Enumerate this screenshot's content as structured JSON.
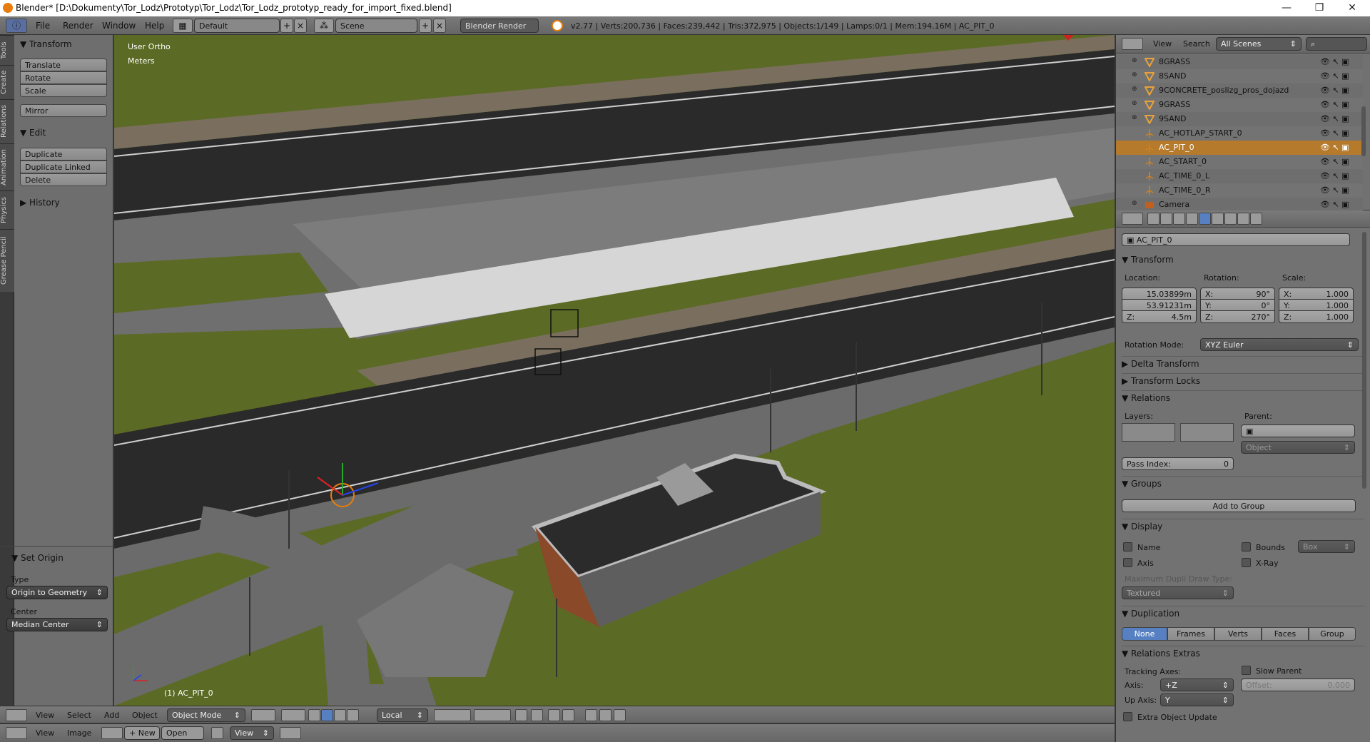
{
  "window": {
    "title": "Blender* [D:\\Dokumenty\\Tor_Lodz\\Prototyp\\Tor_Lodz\\Tor_Lodz_prototyp_ready_for_import_fixed.blend]",
    "min": "—",
    "max": "❐",
    "close": "✕"
  },
  "info": {
    "menus": [
      "File",
      "Render",
      "Window",
      "Help"
    ],
    "layout": "Default",
    "scene": "Scene",
    "engine": "Blender Render",
    "stats": "v2.77 | Verts:200,736 | Faces:239,442 | Tris:372,975 | Objects:1/149 | Lamps:0/1 | Mem:194.16M | AC_PIT_0"
  },
  "tabs": [
    "Tools",
    "Create",
    "Relations",
    "Animation",
    "Physics",
    "Grease Pencil"
  ],
  "shelf": {
    "transform_title": "Transform",
    "transform": [
      "Translate",
      "Rotate",
      "Scale"
    ],
    "mirror": "Mirror",
    "edit_title": "Edit",
    "edit": [
      "Duplicate",
      "Duplicate Linked",
      "Delete"
    ],
    "history_title": "History",
    "origin_title": "Set Origin",
    "type_label": "Type",
    "type_value": "Origin to Geometry",
    "center_label": "Center",
    "center_value": "Median Center"
  },
  "viewport": {
    "view_name": "User Ortho",
    "units": "Meters",
    "object_label": "(1) AC_PIT_0"
  },
  "vpheader": {
    "menus": [
      "View",
      "Select",
      "Add",
      "Object"
    ],
    "mode": "Object Mode",
    "orientation": "Local"
  },
  "imgheader": {
    "menus": [
      "View",
      "Image"
    ],
    "new": "New",
    "open": "Open",
    "view": "View"
  },
  "outliner": {
    "menus": [
      "View",
      "Search"
    ],
    "filter": "All Scenes",
    "rows": [
      {
        "name": "8GRASS",
        "type": "mesh"
      },
      {
        "name": "8SAND",
        "type": "mesh"
      },
      {
        "name": "9CONCRETE_poslizg_pros_dojazd",
        "type": "mesh"
      },
      {
        "name": "9GRASS",
        "type": "mesh"
      },
      {
        "name": "9SAND",
        "type": "mesh"
      },
      {
        "name": "AC_HOTLAP_START_0",
        "type": "empty"
      },
      {
        "name": "AC_PIT_0",
        "type": "empty",
        "selected": true
      },
      {
        "name": "AC_START_0",
        "type": "empty"
      },
      {
        "name": "AC_TIME_0_L",
        "type": "empty"
      },
      {
        "name": "AC_TIME_0_R",
        "type": "empty"
      },
      {
        "name": "Camera",
        "type": "camera"
      }
    ]
  },
  "props": {
    "object_name": "AC_PIT_0",
    "transform_title": "Transform",
    "location_label": "Location:",
    "rotation_label": "Rotation:",
    "scale_label": "Scale:",
    "loc": [
      "15.03899m",
      "53.91231m",
      "4.5m"
    ],
    "rot": [
      "90°",
      "0°",
      "270°"
    ],
    "scale": [
      "1.000",
      "1.000",
      "1.000"
    ],
    "axes": [
      "X:",
      "Y:",
      "Z:"
    ],
    "rotmode_label": "Rotation Mode:",
    "rotmode": "XYZ Euler",
    "delta": "Delta Transform",
    "locks": "Transform Locks",
    "relations_title": "Relations",
    "layers_label": "Layers:",
    "parent_label": "Parent:",
    "parent_type": "Object",
    "pass_index_label": "Pass Index:",
    "pass_index": "0",
    "groups_title": "Groups",
    "add_group": "Add to Group",
    "display_title": "Display",
    "name_chk": "Name",
    "axis_chk": "Axis",
    "bounds_chk": "Bounds",
    "bounds_type": "Box",
    "xray_chk": "X-Ray",
    "dupli_draw_label": "Maximum Dupli Draw Type:",
    "dupli_draw": "Textured",
    "duplication_title": "Duplication",
    "dup": [
      "None",
      "Frames",
      "Verts",
      "Faces",
      "Group"
    ],
    "rel_extras_title": "Relations Extras",
    "tracking_label": "Tracking Axes:",
    "slow_parent": "Slow Parent",
    "axis_label": "Axis:",
    "axis_value": "+Z",
    "offset_label": "Offset:",
    "offset_value": "0.000",
    "upaxis_label": "Up Axis:",
    "upaxis_value": "Y",
    "extra_update": "Extra Object Update"
  },
  "colors": {
    "grass": "#5b6a24",
    "asphalt": "#2a2a2a",
    "concrete": "#707070",
    "white_strip": "#d6d6d6",
    "sel_blue": "#5680c2"
  }
}
